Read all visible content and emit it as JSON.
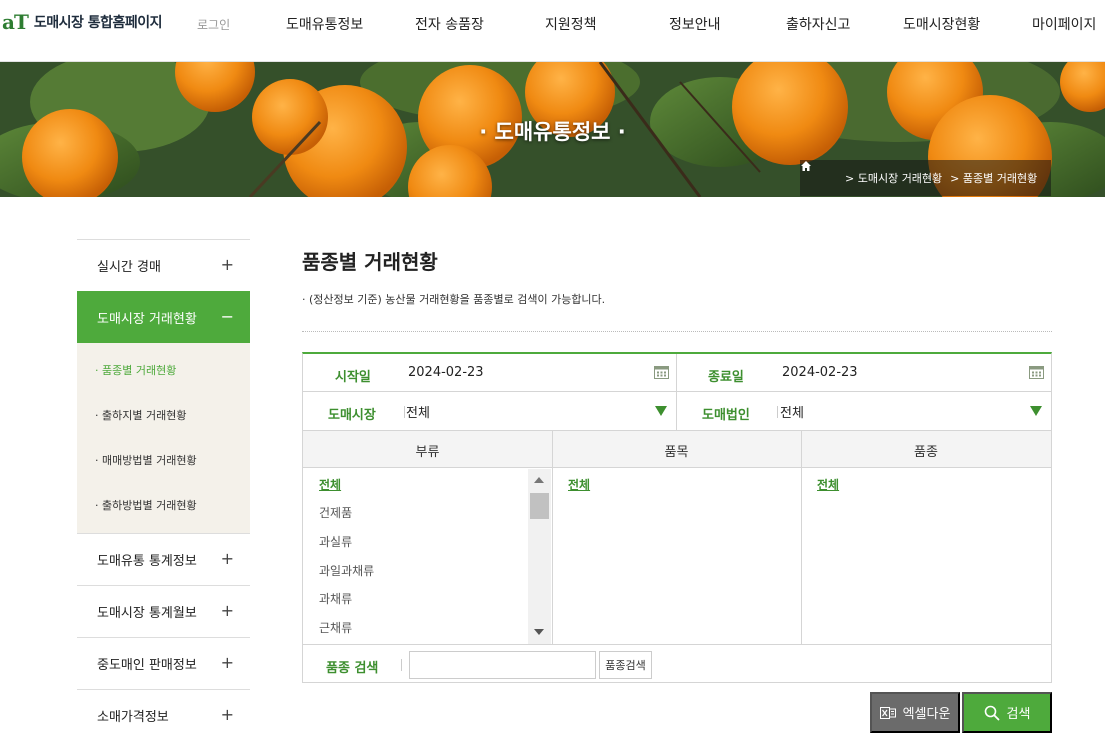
{
  "header": {
    "logo_mark": "aT",
    "logo_text": "도매시장 통합홈페이지",
    "login_label": "로그인",
    "nav": [
      "도매유통정보",
      "전자 송품장",
      "지원정책",
      "정보안내",
      "출하자신고",
      "도매시장현황",
      "마이페이지"
    ]
  },
  "banner": {
    "title": "· 도매유통정보 ·",
    "breadcrumb": [
      "> 도매시장 거래현황",
      "> 품종별 거래현황"
    ]
  },
  "sidebar": {
    "items": [
      {
        "label": "실시간 경매",
        "toggle": "+"
      },
      {
        "label": "도매시장 거래현황",
        "toggle": "−"
      },
      {
        "label": "도매유통 통계정보",
        "toggle": "+"
      },
      {
        "label": "도매시장 통계월보",
        "toggle": "+"
      },
      {
        "label": "중도매인 판매정보",
        "toggle": "+"
      },
      {
        "label": "소매가격정보",
        "toggle": "+"
      }
    ],
    "sub_items": [
      "· 품종별 거래현황",
      "· 출하지별 거래현황",
      "· 매매방법별 거래현황",
      "· 출하방법별 거래현황"
    ]
  },
  "main": {
    "title": "품종별 거래현황",
    "description": "· (정산정보 기준) 농산물 거래현황을 품종별로 검색이 가능합니다.",
    "filters": {
      "start_label": "시작일",
      "start_value": "2024-02-23",
      "end_label": "종료일",
      "end_value": "2024-02-23",
      "market_label": "도매시장",
      "market_value": "전체",
      "corp_label": "도매법인",
      "corp_value": "전체"
    },
    "columns": [
      "부류",
      "품목",
      "품종"
    ],
    "category_list": [
      "전체",
      "건제품",
      "과실류",
      "과일과채류",
      "과채류",
      "근채류"
    ],
    "item_list": [
      "전체"
    ],
    "variety_list": [
      "전체"
    ],
    "search": {
      "label": "품종 검색",
      "placeholder": "",
      "button": "품종검색"
    },
    "buttons": {
      "excel": "엑셀다운",
      "search": "검색"
    }
  },
  "colors": {
    "accent": "#4eaa3c",
    "label_green": "#3d8f2f",
    "excel_gray": "#6b6b6b"
  }
}
